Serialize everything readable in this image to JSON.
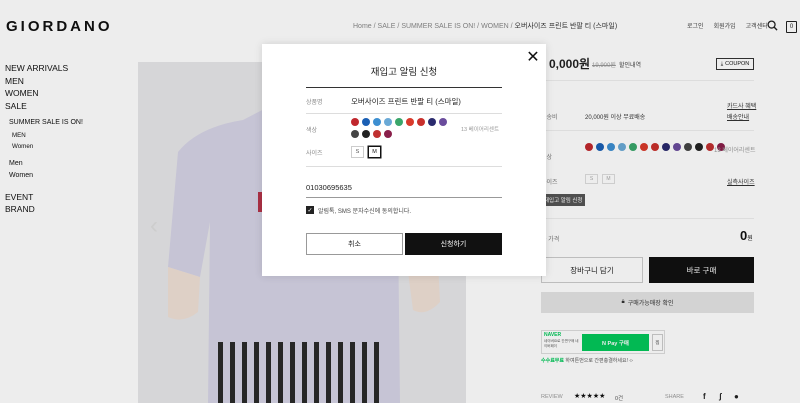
{
  "header": {
    "logo": "GIORDANO",
    "breadcrumb": [
      "Home",
      "SALE",
      "SUMMER SALE IS ON!",
      "WOMEN"
    ],
    "breadcrumb_sep": "/",
    "breadcrumb_current": "오버사이즈 프린트 반팔 티 (스마일)",
    "links": [
      "로그인",
      "회원가입",
      "고객센터"
    ],
    "cart_count": "0"
  },
  "nav": {
    "main": [
      "NEW ARRIVALS",
      "MEN",
      "WOMEN",
      "SALE"
    ],
    "sale_title": "SUMMER SALE IS ON!",
    "sale_sub": [
      "MEN",
      "Women"
    ],
    "sale_items": [
      "Men",
      "Women"
    ],
    "bottom": [
      "EVENT",
      "BRAND"
    ]
  },
  "panel": {
    "price": "0,000원",
    "old_price": "19,900원",
    "discount": "할인내역",
    "coupon": "COUPON",
    "delivery_label": "배송비",
    "delivery_value": "20,000원 이상 무료배송",
    "card_link": "카드사 혜택",
    "delivery_link": "배송안내",
    "color_label": "색상",
    "color_count": "13 베이어리센트",
    "size_label": "사이즈",
    "sizes": [
      "S",
      "M"
    ],
    "size_link": "실측사이즈",
    "alarm_btn": "재입고 알림 신청",
    "total_label": "총 가격",
    "total": "0",
    "total_unit": "원",
    "cart_btn": "장바구니 담기",
    "buy_btn": "바로 구매",
    "store_btn": "구매가능매장 확인",
    "naver": {
      "brand": "NAVER",
      "desc": "네이버ID로 간편구매 네이버페이",
      "pay": "N Pay 구매",
      "wish": "찜",
      "footer_brand": "수수료무료",
      "footer": "하여튼번으로 간편충결하세요!"
    },
    "review_label": "REVIEW",
    "stars": "★★★★★",
    "review_count": "0건",
    "share_label": "SHARE",
    "share_icons": [
      "f",
      "ʃ",
      "●"
    ]
  },
  "modal": {
    "title": "재입고 알림 신청",
    "close": "✕",
    "product_label": "상품명",
    "product_name": "오버사이즈 프린트 반팔 티 (스마일)",
    "color_label": "색상",
    "color_count": "13 베이어리센트",
    "size_label": "사이즈",
    "sizes": [
      "S",
      "M"
    ],
    "selected_size": "M",
    "phone": "01030695635",
    "agree_text": "알림톡, SMS 문자수신에 동의합니다.",
    "cancel": "취소",
    "submit": "신청하기"
  },
  "colors": {
    "swatches": [
      "#c0272d",
      "#1a5fb4",
      "#3d8fd1",
      "#6aa9d6",
      "#3aa66a",
      "#d93a2b",
      "#c9302c",
      "#2b2b6e",
      "#6a4c9c",
      "#444444",
      "#222222",
      "#c03030",
      "#8a1f4a"
    ],
    "accent": "#111111",
    "naver_green": "#03c75a"
  }
}
